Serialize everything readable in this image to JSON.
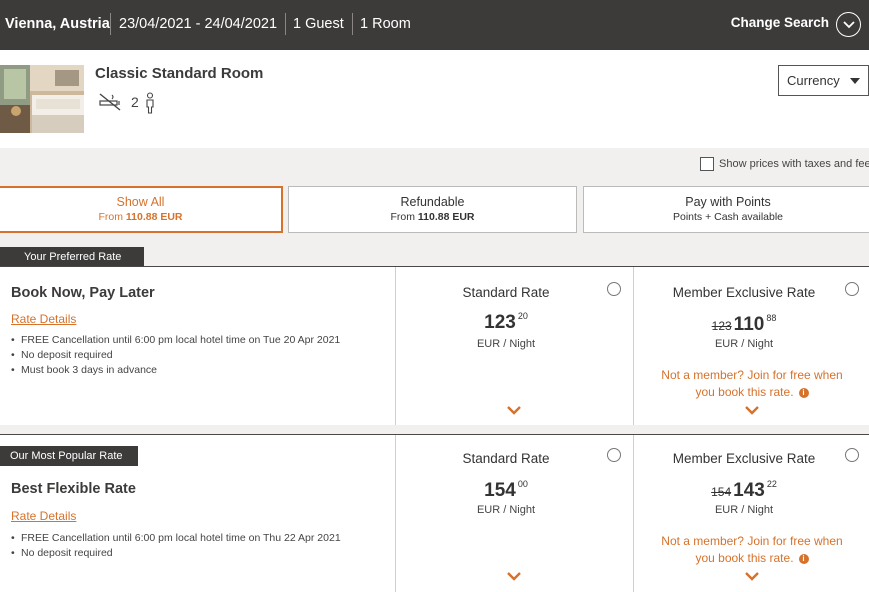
{
  "search": {
    "city": "Vienna, Austria",
    "dates": "23/04/2021 - 24/04/2021",
    "guests": "1 Guest",
    "rooms": "1 Room",
    "change_label": "Change Search"
  },
  "room": {
    "name": "Classic Standard Room",
    "occupancy": "2"
  },
  "currency": {
    "label": "Currency"
  },
  "taxes_toggle": {
    "label": "Show prices with taxes and fees",
    "checked": false
  },
  "filters": [
    {
      "title": "Show All",
      "sub_prefix": "From ",
      "sub_value": "110.88 EUR",
      "active": true
    },
    {
      "title": "Refundable",
      "sub_prefix": "From ",
      "sub_value": "110.88 EUR",
      "active": false
    },
    {
      "title": "Pay with Points",
      "sub_prefix": "Points + Cash available",
      "sub_value": "",
      "active": false
    }
  ],
  "rates": [
    {
      "tag": "Your Preferred Rate",
      "name": "Book Now, Pay Later",
      "details_link": "Rate Details",
      "bullets": [
        "FREE Cancellation until 6:00 pm local hotel time on Tue 20 Apr 2021",
        "No deposit required",
        "Must book 3 days in advance"
      ],
      "standard": {
        "title": "Standard Rate",
        "price": "123",
        "cents": "20",
        "unit": "EUR / Night"
      },
      "member": {
        "title": "Member Exclusive Rate",
        "old_price": "123",
        "price": "110",
        "cents": "88",
        "unit": "EUR / Night",
        "promo_line1": "Not a member? Join for free when",
        "promo_line2": "you book this rate."
      }
    },
    {
      "tag": "Our Most Popular Rate",
      "name": "Best Flexible Rate",
      "details_link": "Rate Details",
      "bullets": [
        "FREE Cancellation until 6:00 pm local hotel time on Thu 22 Apr 2021",
        "No deposit required"
      ],
      "standard": {
        "title": "Standard Rate",
        "price": "154",
        "cents": "00",
        "unit": "EUR / Night"
      },
      "member": {
        "title": "Member Exclusive Rate",
        "old_price": "154",
        "price": "143",
        "cents": "22",
        "unit": "EUR / Night",
        "promo_line1": "Not a member? Join for free when",
        "promo_line2": "you book this rate."
      }
    }
  ],
  "colors": {
    "header_bg": "#3d3b3a",
    "accent": "#d6722c",
    "page_bg": "#f1f0ee"
  },
  "icons": [
    "chevron-down-icon",
    "no-smoking-icon",
    "person-icon",
    "caret-down-icon",
    "info-icon"
  ]
}
